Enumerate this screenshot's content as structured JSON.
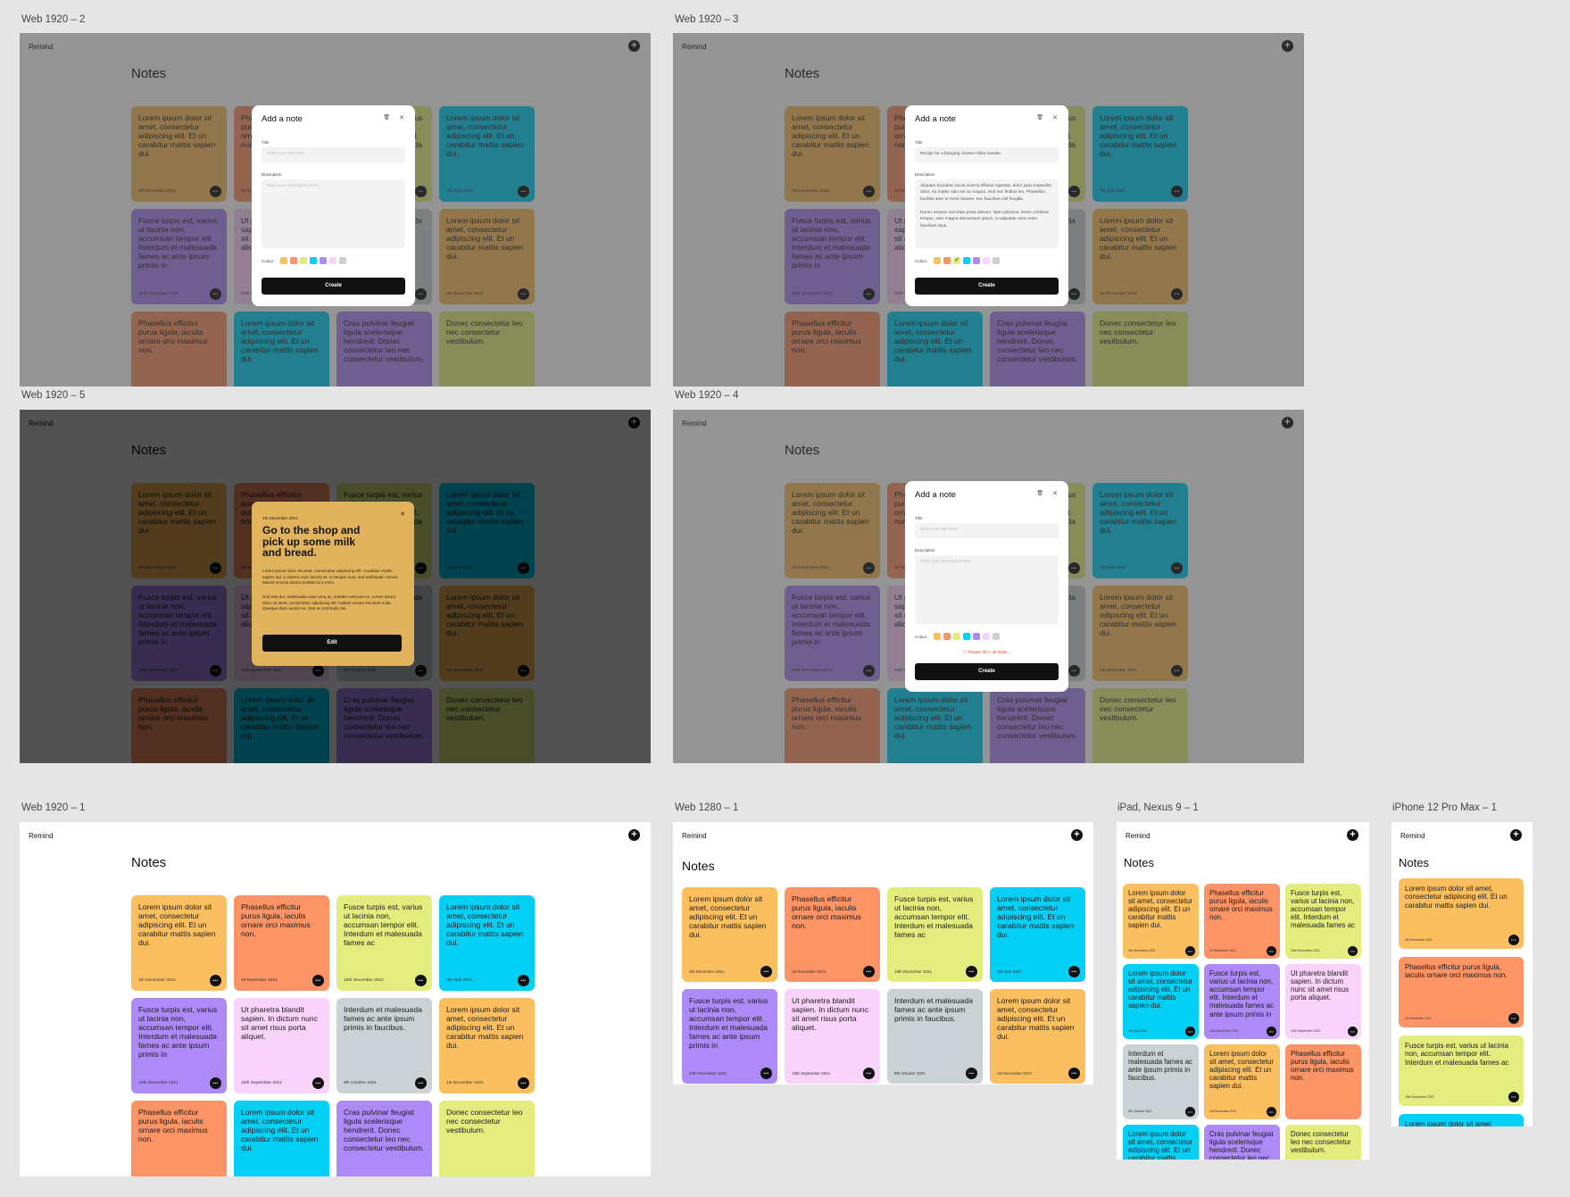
{
  "app": {
    "brand": "Remind",
    "page_title": "Notes",
    "add_icon": "plus-circle-icon",
    "more_icon": "ellipsis-icon"
  },
  "frame_labels": {
    "f2": "Web 1920 – 2",
    "f3": "Web 1920 – 3",
    "f5": "Web 1920 – 5",
    "f4": "Web 1920 – 4",
    "f1": "Web 1920 – 1",
    "f1280": "Web 1280 – 1",
    "ipad": "iPad, Nexus 9 – 1",
    "iphone": "iPhone 12 Pro Max – 1"
  },
  "notes": [
    {
      "text": "Lorem ipsum dolor sit amet, consectetur adipiscing elit. Et un carabitur mattis sapien dui.",
      "date": "4th December 2021",
      "color": "#fcbf5f"
    },
    {
      "text": "Phasellus efficitur purus ligula, iaculis ornare orci maximus non.",
      "date": "19 November 2021",
      "color": "#fc9466"
    },
    {
      "text": "Fusce turpis est, varius ut lacinia non, accumsan tempor elit. Interdum et malesuada fames ac",
      "date": "18th December 2021",
      "color": "#e2ed7d"
    },
    {
      "text": "Lorem ipsum dolor sit amet, consectetur adipiscing elit. Et un carabitur mattis sapien dui.",
      "date": "7th April 2021",
      "color": "#03d0f4"
    },
    {
      "text": "Fusce turpis est, varius ut lacinia non, accumsan tempor elit. Interdum et malesuada fames ac ante ipsum primis in",
      "date": "24th December 2021",
      "color": "#ae89f8"
    },
    {
      "text": "Ut pharetra blandit sapien. In dictum nunc sit amet risus porta aliquet.",
      "date": "10th September 2021",
      "color": "#fad3fb"
    },
    {
      "text": "Interdum et malesuada fames ac ante ipsum primis in faucibus.",
      "date": "9th October 2021",
      "color": "#cbd2d6"
    },
    {
      "text": "Lorem ipsum dolor sit amet, consectetur adipiscing elit. Et un carabitur mattis sapien dui.",
      "date": "1st December 2021",
      "color": "#fcbf5f"
    },
    {
      "text": "Phasellus efficitur purus ligula, iaculis ornare orci maximus non.",
      "date": "",
      "color": "#fc9466"
    },
    {
      "text": "Lorem ipsum dolor sit amet, consectetur adipiscing elit. Et un carabitur mattis sapien dui.",
      "date": "",
      "color": "#03d0f4"
    },
    {
      "text": "Cras pulvinar feugiat ligula scelerisque hendrerit. Donec consectetur leo nec consectetur vestibulum.",
      "date": "",
      "color": "#ae89f8"
    },
    {
      "text": "Donec consectetur leo nec consectetur vestibulum.",
      "date": "",
      "color": "#e2ed7d"
    }
  ],
  "modal": {
    "title": "Add a note",
    "trash_icon": "trash-icon",
    "close_icon": "close-icon",
    "title_label": "Title",
    "title_placeholder": "Write your title here...",
    "title_value": "Recipe for a banging chicken tikka masala",
    "description_label": "Description",
    "description_placeholder": "Write your description here...",
    "description_value": "Aliquam tincidunt, lacus viverra efficitur egestas, dolor justo imperdiet dolor, eu mattis odio est ac magna. Sed nec finibus leo. Phasellus facilisis ante et tortor laoreet, nec faucibus nisl fringilla.\n\nDonec tempor nisl vitae porta ultrices. Nam placerat, lorem a finibus tempor, sem magna elementum ipsum, a vulputate enim enim faucibus risus.",
    "colour_label": "Colour",
    "swatches": [
      "#fcbf5f",
      "#fc9466",
      "#e2ed7d",
      "#03d0f4",
      "#ae89f8",
      "#fad3fb",
      "#cbd2d6"
    ],
    "selected_swatch": 2,
    "create_label": "Create",
    "error_text": "ⓘ Please fill in all fields..."
  },
  "view_card": {
    "date": "4th December 2021",
    "title": "Go to the shop and pick up some milk and bread.",
    "para1": "Lorem ipsum dolor sit amet, consectetur adipiscing elit. Curabitur mattis sapien dui, a viverra nunc lacinia sit. In tempor nunc sed sollicitudin rutrum. Mauris et eros auctor porttitor id a enim.",
    "para2": "Sed erat dui, malesuada vitae urna ac, sodales vehicula ex. Lorem ipsum dolor sit amet, consectetur adipiscing elit. Nullam ornare tincidunt nulla. Quisque diam auctor ex. Sed at commodo dui.",
    "edit_label": "Edit",
    "close_icon": "close-icon"
  },
  "overlay_colors": {
    "light": "rgba(60,60,60,0.55)",
    "dark": "rgba(0,0,0,0.68)"
  }
}
